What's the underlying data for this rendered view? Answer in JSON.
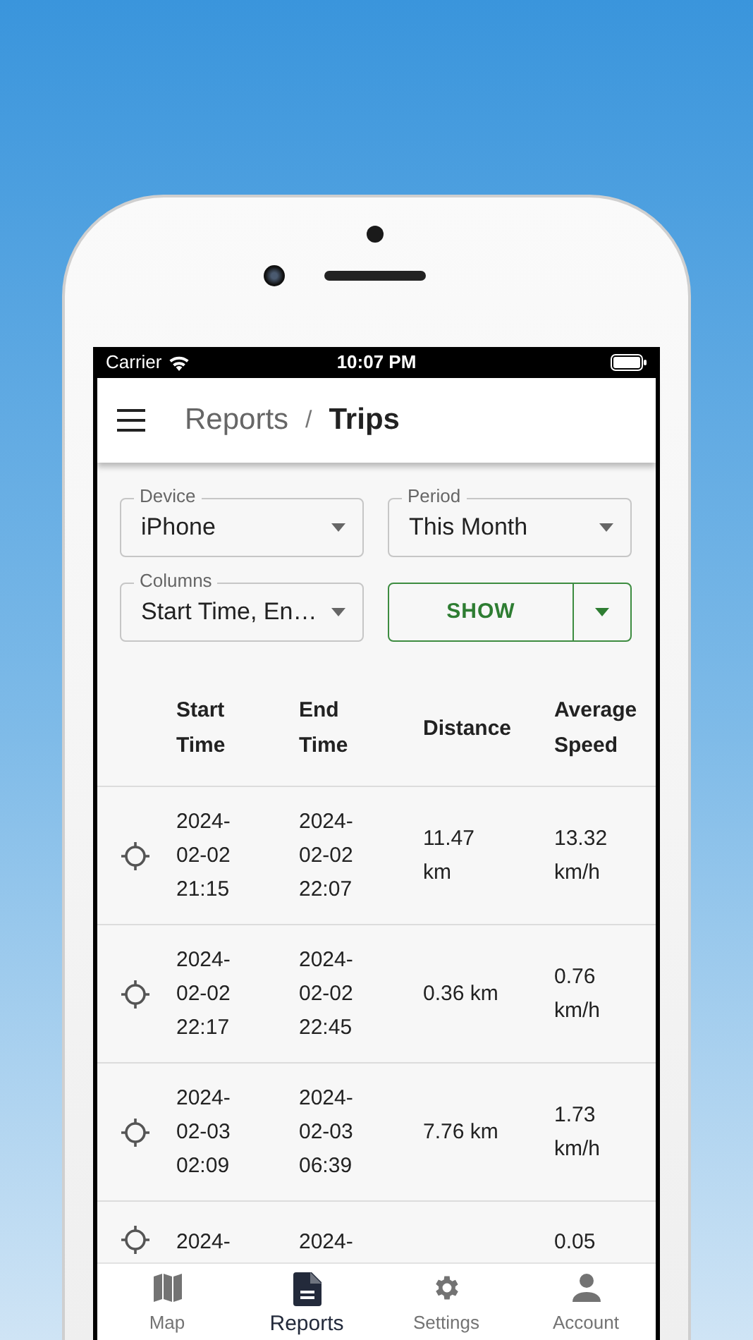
{
  "status_bar": {
    "carrier": "Carrier",
    "time": "10:07 PM"
  },
  "app_bar": {
    "breadcrumb": [
      "Reports",
      "Trips"
    ],
    "separator": "/"
  },
  "filters": [
    {
      "label": "Device",
      "value": "iPhone"
    },
    {
      "label": "Period",
      "value": "This Month"
    },
    {
      "label": "Columns",
      "value": "Start Time, En…"
    }
  ],
  "show_button": "SHOW",
  "table": {
    "columns": [
      "Start\nTime",
      "End\nTime",
      "Distance",
      "Average\nSpeed"
    ],
    "rows": [
      {
        "start": "2024-\n02-02\n21:15",
        "end": "2024-\n02-02\n22:07",
        "distance": "11.47\nkm",
        "speed": "13.32\nkm/h"
      },
      {
        "start": "2024-\n02-02\n22:17",
        "end": "2024-\n02-02\n22:45",
        "distance": "0.36 km",
        "speed": "0.76\nkm/h"
      },
      {
        "start": "2024-\n02-03\n02:09",
        "end": "2024-\n02-03\n06:39",
        "distance": "7.76 km",
        "speed": "1.73\nkm/h"
      },
      {
        "start": "2024-",
        "end": "2024-",
        "speed": "0.05"
      }
    ]
  },
  "nav": [
    {
      "label": "Map",
      "kind": "map",
      "selected": false
    },
    {
      "label": "Reports",
      "kind": "report",
      "selected": true
    },
    {
      "label": "Settings",
      "kind": "settings",
      "selected": false
    },
    {
      "label": "Account",
      "kind": "account",
      "selected": false
    }
  ]
}
